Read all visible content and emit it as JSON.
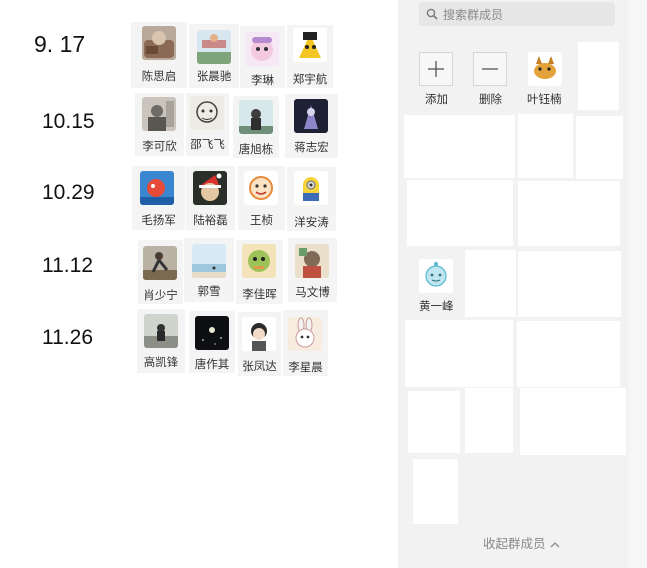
{
  "schedule": [
    {
      "date": "9. 17",
      "members": [
        "陈思启",
        "张晨驰",
        "李琳",
        "郑宇航"
      ]
    },
    {
      "date": "10.15",
      "members": [
        "李可欣",
        "邵飞飞",
        "唐旭栋",
        "蒋志宏"
      ]
    },
    {
      "date": "10.29",
      "members": [
        "毛扬军",
        "陆裕磊",
        "王桢",
        "洋安涛"
      ]
    },
    {
      "date": "11.12",
      "members": [
        "肖少宁",
        "郭雪",
        "李佳晖",
        "马文博"
      ]
    },
    {
      "date": "11.26",
      "members": [
        "高凯锋",
        "唐作其",
        "张凤达",
        "李星晨"
      ]
    }
  ],
  "panel": {
    "search_placeholder": "搜索群成员",
    "add_label": "添加",
    "remove_label": "删除",
    "member_ye": "叶钰楠",
    "member_huang": "黄一峰",
    "collapse_label": "收起群成员"
  },
  "colors": {
    "panel_bg": "#f2f2f2",
    "tile_bg": "#f4f4f4",
    "muted_text": "#8a8a8a"
  }
}
